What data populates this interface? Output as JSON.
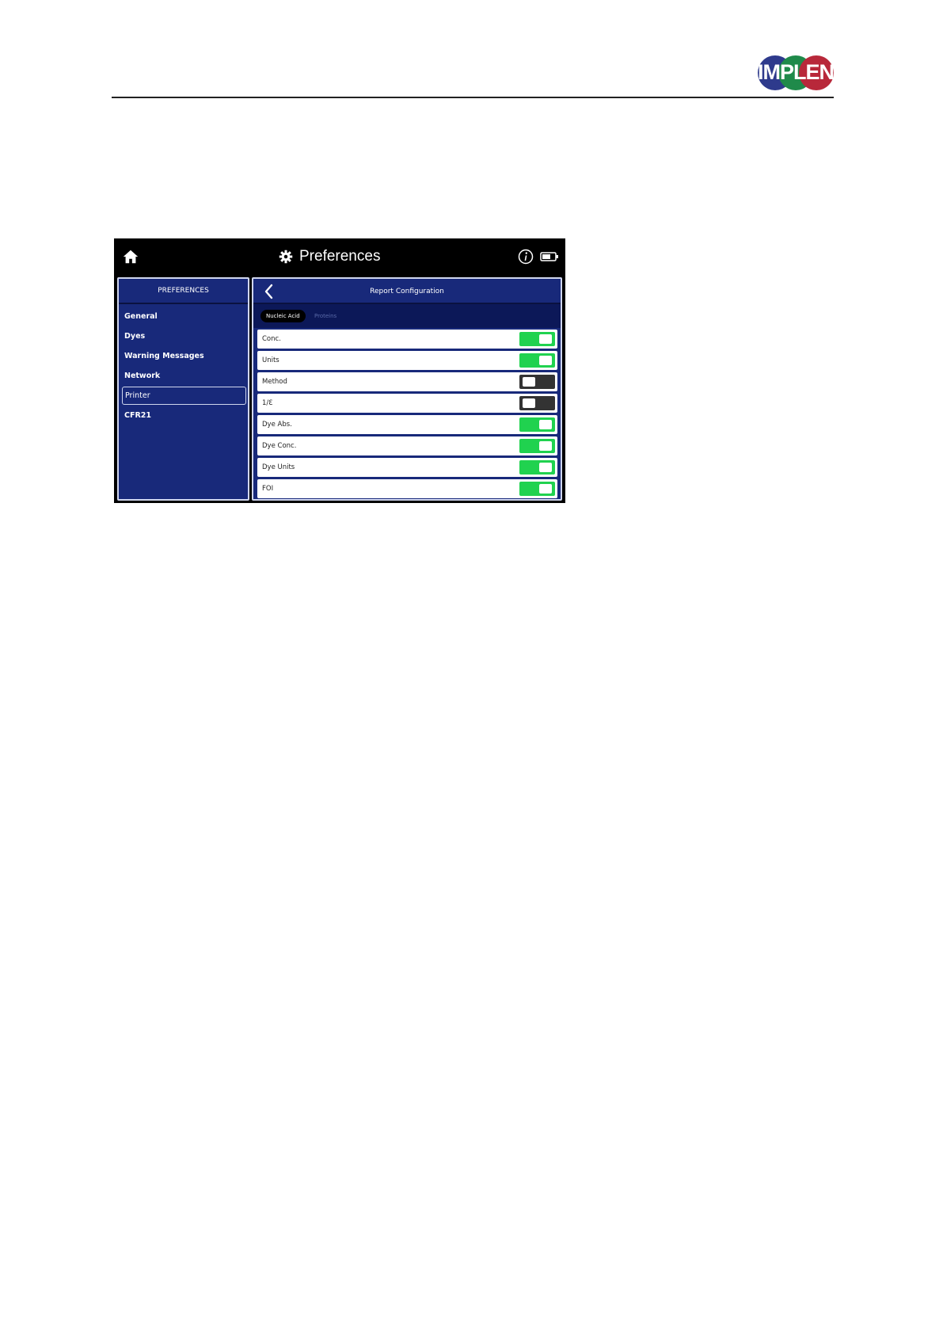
{
  "document": {
    "logo_text": "IMPLEN",
    "logo_colors": [
      "#2e3a8c",
      "#1f8a4a",
      "#b8283a"
    ]
  },
  "device": {
    "title": "Preferences",
    "icons": {
      "home": "home-icon",
      "settings": "gear-icon",
      "info": "info-icon",
      "battery": "battery-icon",
      "back": "chevron-left-icon"
    },
    "colors": {
      "panel": "#18297a",
      "toggle_on": "#20d24f",
      "toggle_off": "#333333"
    },
    "sidebar": {
      "heading": "PREFERENCES",
      "items": [
        {
          "label": "General"
        },
        {
          "label": "Dyes"
        },
        {
          "label": "Warning Messages"
        },
        {
          "label": "Network"
        },
        {
          "label": "Printer",
          "selected": true
        },
        {
          "label": "CFR21"
        }
      ]
    },
    "main": {
      "title": "Report Configuration",
      "tabs": [
        {
          "label": "Nucleic Acid",
          "active": true
        },
        {
          "label": "Proteins",
          "active": false
        }
      ],
      "rows": [
        {
          "label": "Conc.",
          "enabled": true
        },
        {
          "label": "Units",
          "enabled": true
        },
        {
          "label": "Method",
          "enabled": false
        },
        {
          "label": "1/Ɛ",
          "enabled": false
        },
        {
          "label": "Dye Abs.",
          "enabled": true
        },
        {
          "label": "Dye Conc.",
          "enabled": true
        },
        {
          "label": "Dye Units",
          "enabled": true
        },
        {
          "label": "FOI",
          "enabled": true
        }
      ]
    }
  }
}
